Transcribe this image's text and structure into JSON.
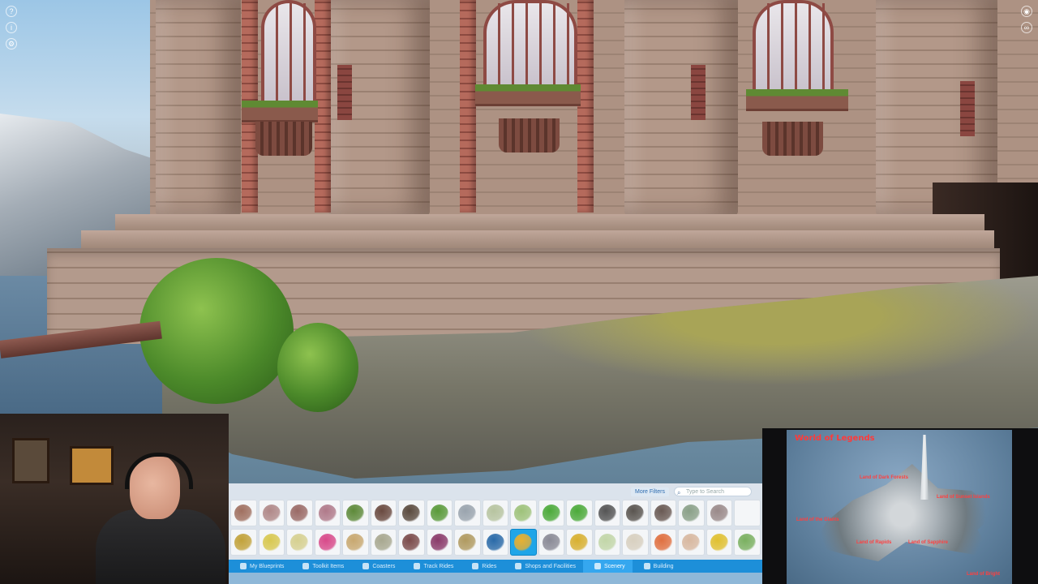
{
  "hud": {
    "left_icons": [
      "help-icon",
      "info-icon",
      "settings-icon"
    ],
    "right_icons": [
      "camera-icon",
      "link-icon"
    ]
  },
  "toolbar": {
    "more_filters_label": "More Filters",
    "search_placeholder": "Type to Search",
    "tabs": [
      {
        "label": "My Blueprints",
        "icon": "blueprint-icon",
        "active": false
      },
      {
        "label": "Toolkit Items",
        "icon": "toolkit-icon",
        "active": false
      },
      {
        "label": "Coasters",
        "icon": "coaster-icon",
        "active": false
      },
      {
        "label": "Track Rides",
        "icon": "track-ride-icon",
        "active": false
      },
      {
        "label": "Rides",
        "icon": "ride-icon",
        "active": false
      },
      {
        "label": "Shops and Facilities",
        "icon": "shop-icon",
        "active": false
      },
      {
        "label": "Scenery",
        "icon": "scenery-icon",
        "active": true
      },
      {
        "label": "Building",
        "icon": "building-icon",
        "active": false
      }
    ],
    "items_row1": [
      "#a07060",
      "#b08888",
      "#9a6a66",
      "#b07a8a",
      "#5e8a3a",
      "#6a4a40",
      "#5a4a3e",
      "#5a9a3a",
      "#9aa4ae",
      "#b7c4a0",
      "#9ec27a",
      "#4caa3a",
      "#4caa3a",
      "#555555",
      "#5a5550",
      "#6a5a54",
      "#8aa088",
      "#9a8a8a"
    ],
    "items_row2": [
      "#c2a23a",
      "#d8c850",
      "#d6d090",
      "#d84a8a",
      "#c8a870",
      "#a8a890",
      "#7a4a4a",
      "#8a3a6a",
      "#b09a60",
      "#2a6aa8",
      "#e8b030",
      "#8a8a96",
      "#d8b030",
      "#c2d6a8",
      "#d8d0c0",
      "#e07040",
      "#d8b8a0",
      "#e0c030",
      "#7ab060"
    ],
    "selected_item": {
      "row": 2,
      "index": 10
    }
  },
  "minimap": {
    "title": "World of Legends",
    "labels": [
      "Land of Dark Forests",
      "Land of Sunset Islands",
      "Land of the Giants",
      "Land of Rapids",
      "Land of Sapphire",
      "Land of Bright"
    ]
  }
}
